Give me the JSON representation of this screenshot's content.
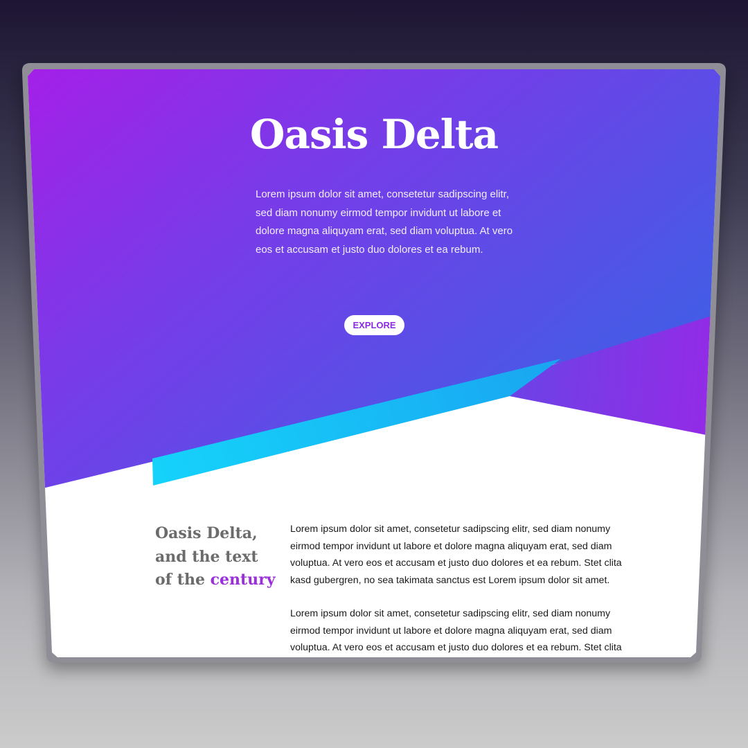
{
  "hero": {
    "title": "Oasis Delta",
    "text": "Lorem ipsum dolor sit amet, consetetur sadipscing elitr, sed diam nonumy eirmod tempor invidunt ut labore et dolore magna aliquyam erat, sed diam voluptua. At vero eos et accusam et justo duo dolores et ea rebum.",
    "button_label": "EXPLORE"
  },
  "content": {
    "heading_part1": "Oasis Delta, and the text of the",
    "heading_accent": "century",
    "paragraphs": [
      "Lorem ipsum dolor sit amet, consetetur sadipscing elitr, sed diam nonumy eirmod tempor invidunt ut labore et dolore magna aliquyam erat, sed diam voluptua. At vero eos et accusam et justo duo dolores et ea rebum. Stet clita kasd gubergren, no sea takimata sanctus est Lorem ipsum dolor sit amet.",
      "Lorem ipsum dolor sit amet, consetetur sadipscing elitr, sed diam nonumy eirmod tempor invidunt ut labore et dolore magna aliquyam erat, sed diam voluptua. At vero eos et accusam et justo duo dolores et ea rebum. Stet clita"
    ]
  },
  "colors": {
    "accent": "#9b2fd9",
    "button_text": "#8a2be2",
    "heading_gray": "#6b6b6b"
  }
}
